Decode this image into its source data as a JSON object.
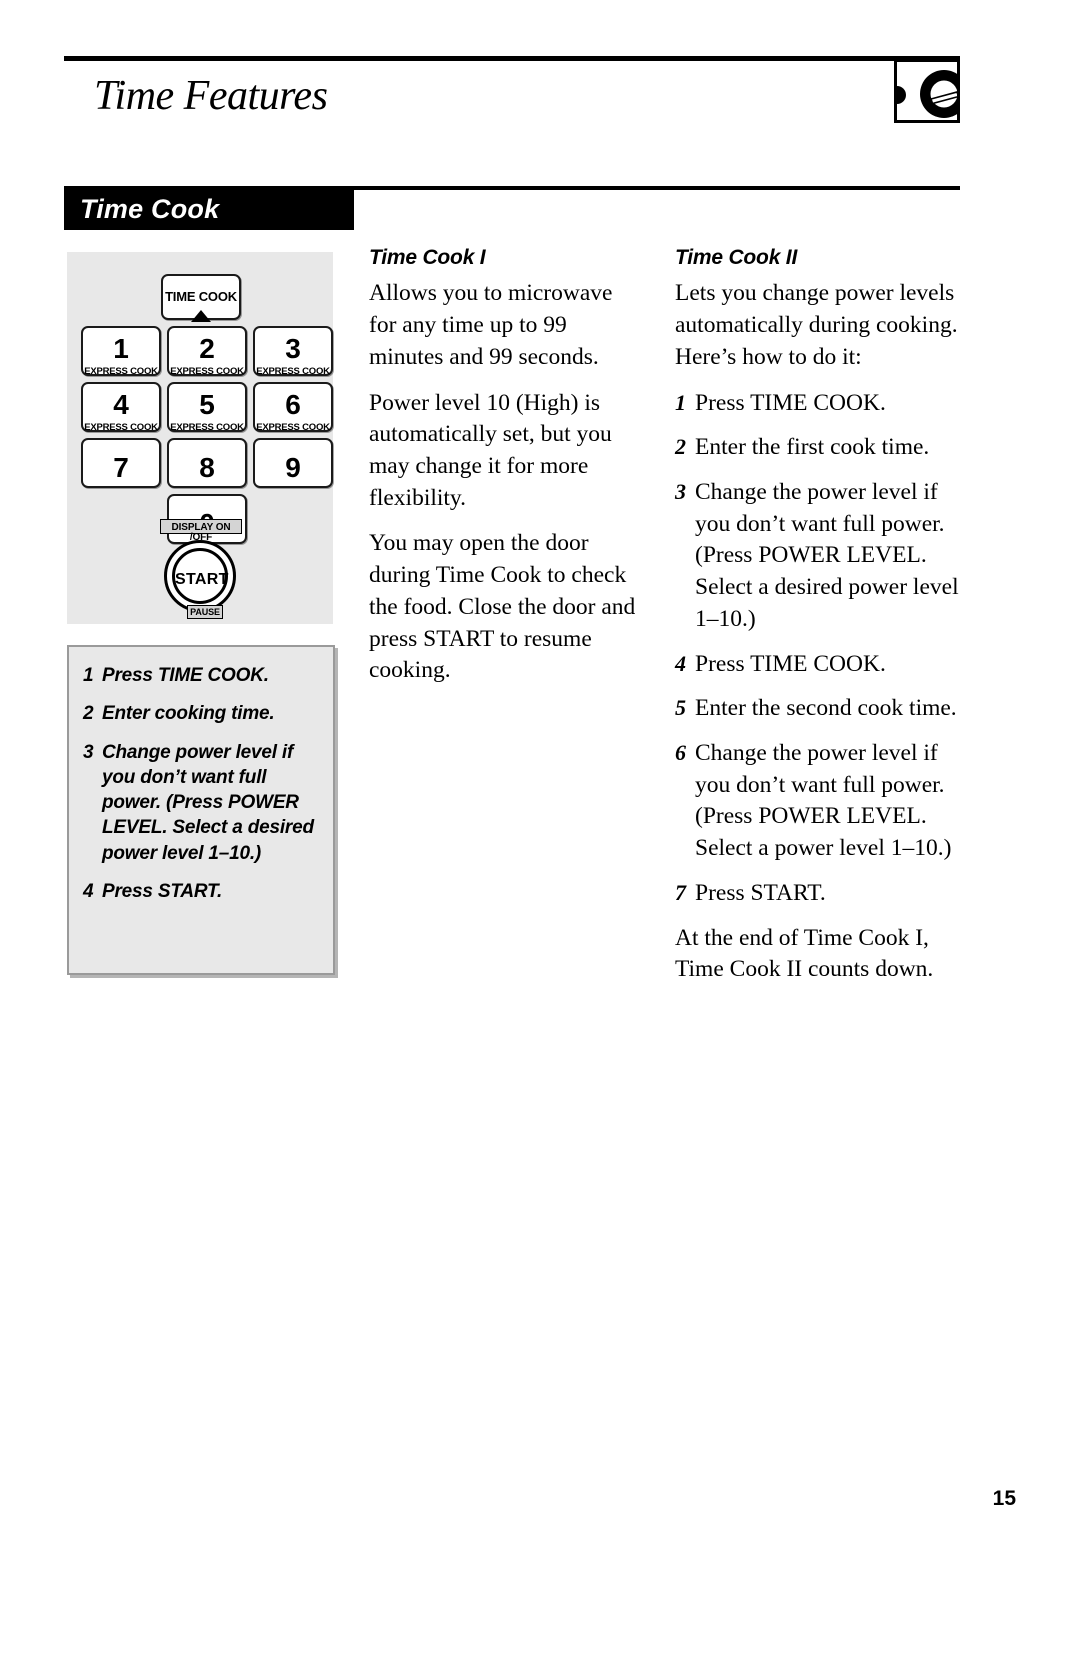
{
  "header": {
    "title": "Time Features",
    "icon_name": "knob-dial-icon"
  },
  "section": {
    "title": "Time Cook"
  },
  "keypad": {
    "time_cook_label": "TIME COOK",
    "express_cook_label": "EXPRESS COOK",
    "keys": [
      {
        "num": "1",
        "sub": "EXPRESS COOK"
      },
      {
        "num": "2",
        "sub": "EXPRESS COOK"
      },
      {
        "num": "3",
        "sub": "EXPRESS COOK"
      },
      {
        "num": "4",
        "sub": "EXPRESS COOK"
      },
      {
        "num": "5",
        "sub": "EXPRESS COOK"
      },
      {
        "num": "6",
        "sub": "EXPRESS COOK"
      },
      {
        "num": "7",
        "sub": ""
      },
      {
        "num": "8",
        "sub": ""
      },
      {
        "num": "9",
        "sub": ""
      },
      {
        "num": "0",
        "sub": ""
      }
    ],
    "display_label": "DISPLAY ON /OFF",
    "start_label": "START",
    "pause_label": "PAUSE"
  },
  "steps_box": {
    "steps": [
      {
        "n": "1",
        "text": "Press TIME COOK."
      },
      {
        "n": "2",
        "text": "Enter cooking time."
      },
      {
        "n": "3",
        "text": "Change power level if you don’t want full power. (Press POWER LEVEL. Select a desired power level 1–10.)"
      },
      {
        "n": "4",
        "text": "Press START."
      }
    ]
  },
  "time_cook_1": {
    "heading": "Time Cook I",
    "paragraphs": [
      "Allows you to microwave for any time up to 99 minutes and 99 seconds.",
      "Power level 10 (High) is automatically set, but you may change it for more flexibility.",
      "You may open the door during Time Cook to check the food. Close the door and press START to resume cooking."
    ]
  },
  "time_cook_2": {
    "heading": "Time Cook II",
    "intro": "Lets you change power levels automatically during cooking. Here’s how to do it:",
    "steps": [
      {
        "n": "1",
        "text": "Press TIME COOK."
      },
      {
        "n": "2",
        "text": "Enter the first cook time."
      },
      {
        "n": "3",
        "text": "Change the power level if you don’t want full power. (Press POWER LEVEL. Select a desired power level 1–10.)"
      },
      {
        "n": "4",
        "text": "Press TIME COOK."
      },
      {
        "n": "5",
        "text": "Enter the second cook time."
      },
      {
        "n": "6",
        "text": "Change the power level if you don’t want full power. (Press POWER LEVEL. Select a power level 1–10.)"
      },
      {
        "n": "7",
        "text": "Press START."
      }
    ],
    "closing": "At the end of Time Cook I, Time Cook II counts down."
  },
  "footer": {
    "page_number": "15"
  }
}
